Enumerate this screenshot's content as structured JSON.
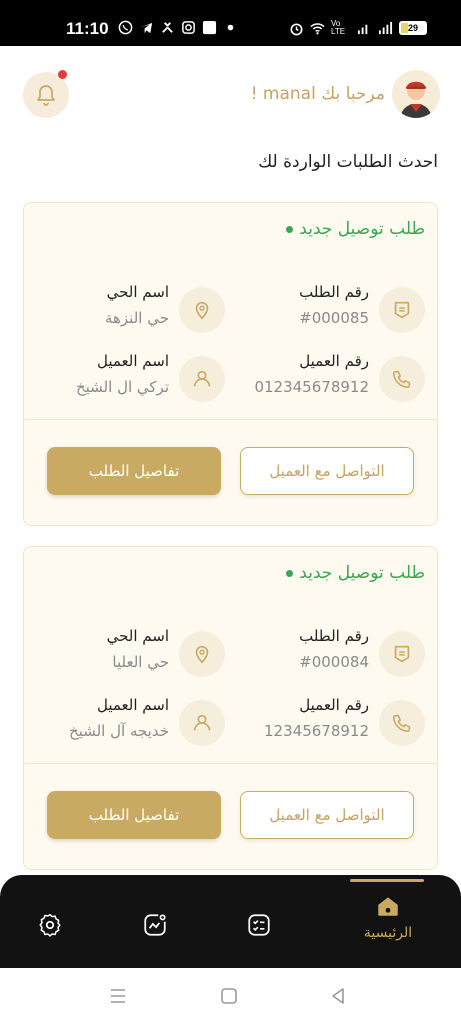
{
  "status_bar": {
    "time": "11:10",
    "battery": "29",
    "battery_level": 0.29,
    "network": "Vo LTE"
  },
  "header": {
    "welcome": "مرحبا بك manal !"
  },
  "section_title": "احدث الطلبات الواردة لك",
  "orders": [
    {
      "status": "طلب توصيل جديد",
      "order_number_label": "رقم الطلب",
      "order_number": "#000085",
      "district_label": "اسم الحي",
      "district": "حي النزهة",
      "customer_number_label": "رقم العميل",
      "customer_number": "012345678912",
      "customer_name_label": "اسم العميل",
      "customer_name": "تركي ال الشيخ",
      "contact_button": "التواصل مع العميل",
      "details_button": "تفاصيل الطلب"
    },
    {
      "status": "طلب توصيل جديد",
      "order_number_label": "رقم الطلب",
      "order_number": "#000084",
      "district_label": "اسم الحي",
      "district": "حي العليا",
      "customer_number_label": "رقم العميل",
      "customer_number": "12345678912",
      "customer_name_label": "اسم العميل",
      "customer_name": "خديجه آل الشيخ",
      "contact_button": "التواصل مع العميل",
      "details_button": "تفاصيل الطلب"
    }
  ],
  "bottom_nav": {
    "home_label": "الرئيسية",
    "active": "home"
  },
  "colors": {
    "accent": "#c8aa63",
    "status_green": "#3aa655",
    "card_bg": "#fffaf0",
    "nav_bg": "#121212"
  },
  "icons": [
    "bell-icon",
    "receipt-icon",
    "location-icon",
    "phone-icon",
    "user-icon",
    "home-icon",
    "checklist-icon",
    "chart-icon",
    "gear-icon"
  ]
}
